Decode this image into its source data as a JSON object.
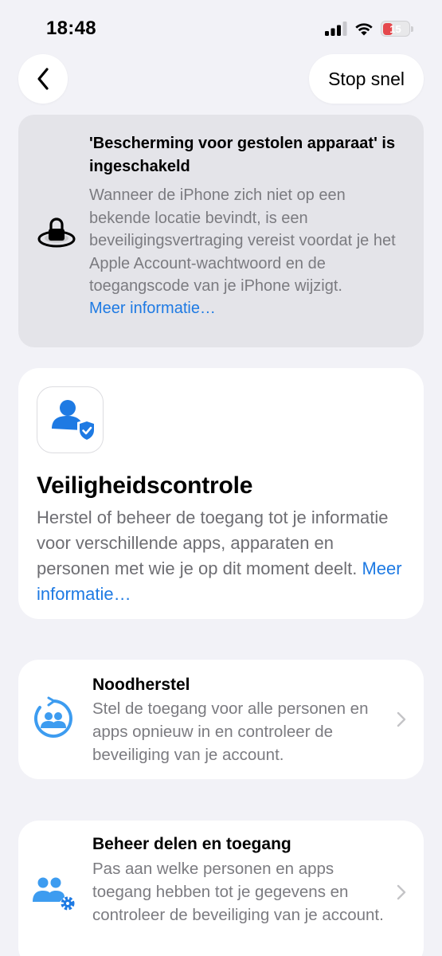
{
  "status_bar": {
    "time": "18:48",
    "battery_level": "15",
    "battery_color": "#e5484d"
  },
  "nav": {
    "back_icon": "chevron-left-icon",
    "stop_label": "Stop snel"
  },
  "stolen_device": {
    "icon": "lock-platter-icon",
    "title": "'Bescherming voor gestolen apparaat' is ingeschakeld",
    "body": "Wanneer de iPhone zich niet op een bekende locatie bevindt, is een beveiligingsvertraging vereist voordat je het Apple Account-wachtwoord en de toegangscode van je iPhone wijzigt.",
    "link": "Meer informatie…"
  },
  "safety_check": {
    "icon": "person-shield-check-icon",
    "title": "Veiligheidscontrole",
    "body": "Herstel of beheer de toegang tot je informatie voor verschillende apps, apparaten en personen met wie je op dit moment deelt. ",
    "link": "Meer informatie…"
  },
  "options": [
    {
      "icon": "people-circle-arrow-icon",
      "title": "Noodherstel",
      "description": "Stel de toegang voor alle personen en apps opnieuw in en controleer de beveiliging van je account."
    },
    {
      "icon": "people-gear-icon",
      "title": "Beheer delen en toegang",
      "description": "Pas aan welke personen en apps toegang hebben tot je gegevens en controleer de beveiliging van je account."
    }
  ],
  "colors": {
    "accent": "#1e7ae3",
    "icon_blue": "#3d9cf0",
    "background": "#f2f2f7",
    "secondary_text": "#7b7b80"
  }
}
